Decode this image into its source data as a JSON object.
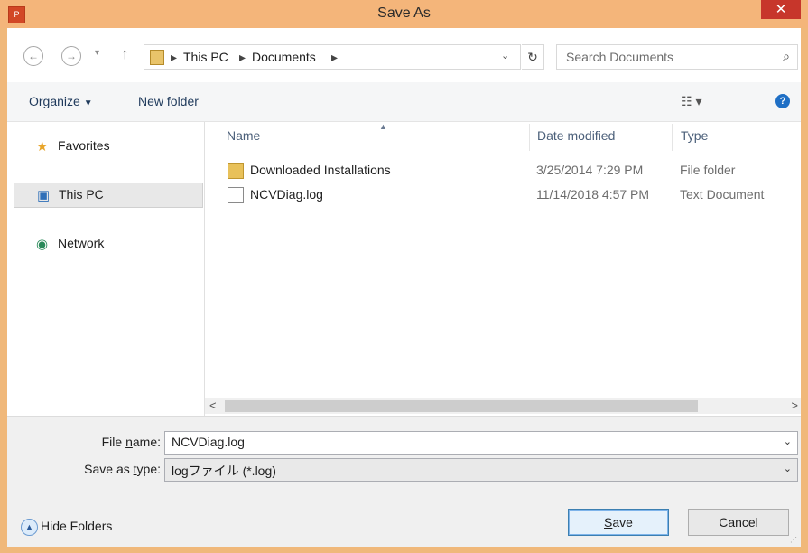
{
  "window": {
    "title": "Save As",
    "close_glyph": "✕",
    "app_icon": "powerpoint-icon"
  },
  "nav": {
    "back_glyph": "←",
    "forward_glyph": "→",
    "recent_glyph": "▾",
    "up_glyph": "↑",
    "breadcrumb": [
      "This PC",
      "Documents"
    ],
    "breadcrumb_sep": "▸",
    "address_dropdown_glyph": "⌄",
    "refresh_glyph": "↻",
    "search_placeholder": "Search Documents",
    "search_glyph": "⌕"
  },
  "toolbar": {
    "organize_label": "Organize",
    "organize_glyph": "▼",
    "new_folder_label": "New folder",
    "view_glyph": "☷ ▾",
    "help_glyph": "?"
  },
  "sidebar": {
    "items": [
      {
        "label": "Favorites",
        "icon": "star-icon",
        "glyph": "★"
      },
      {
        "label": "This PC",
        "icon": "computer-icon",
        "glyph": "▣"
      },
      {
        "label": "Network",
        "icon": "network-icon",
        "glyph": "◉"
      }
    ]
  },
  "files": {
    "columns": [
      "Name",
      "Date modified",
      "Type"
    ],
    "rows": [
      {
        "name": "Downloaded Installations",
        "date": "3/25/2014 7:29 PM",
        "type": "File folder",
        "icon": "folder-icon"
      },
      {
        "name": "NCVDiag.log",
        "date": "11/14/2018 4:57 PM",
        "type": "Text Document",
        "icon": "text-document-icon"
      }
    ],
    "scroll_left_glyph": "<",
    "scroll_right_glyph": ">"
  },
  "save": {
    "file_name_label_pre": "File ",
    "file_name_label_ul": "n",
    "file_name_label_post": "ame:",
    "file_name_value": "NCVDiag.log",
    "type_label_pre": "Save as ",
    "type_label_ul": "t",
    "type_label_post": "ype:",
    "type_value": "logファイル (*.log)",
    "dropdown_glyph": "⌄",
    "hide_folders_label": "Hide Folders",
    "hide_folders_glyph": "▲",
    "save_label_ul": "S",
    "save_label_rest": "ave",
    "cancel_label": "Cancel"
  },
  "colors": {
    "titlebar": "#f4b57a",
    "close": "#c7362b",
    "accent": "#1e395b"
  }
}
